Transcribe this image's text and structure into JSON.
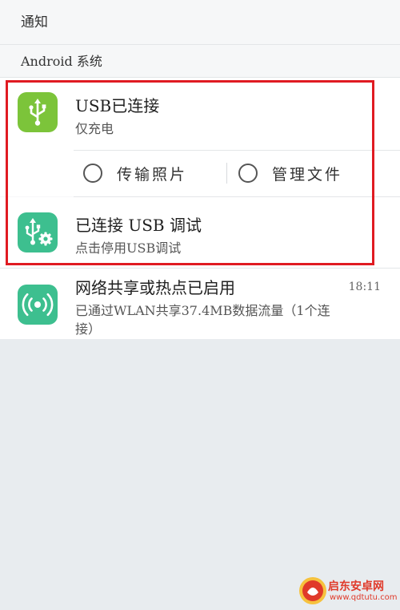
{
  "header": {
    "title": "通知"
  },
  "group": {
    "title": "Android 系统"
  },
  "notifications": [
    {
      "title": "USB已连接",
      "subtitle": "仅充电",
      "icon": "usb-icon",
      "icon_color": "#7cc43a",
      "actions": [
        {
          "label": "传输照片"
        },
        {
          "label": "管理文件"
        }
      ]
    },
    {
      "title": "已连接 USB 调试",
      "subtitle": "点击停用USB调试",
      "icon": "usb-debug-icon",
      "icon_color": "#3dbf8f"
    },
    {
      "title": "网络共享或热点已启用",
      "time": "18:11",
      "subtitle_line1": "已通过WLAN共享37.4MB数据流量（1个连",
      "subtitle_line2": "接）",
      "icon": "hotspot-icon",
      "icon_color": "#3dbf8f"
    }
  ],
  "watermark": {
    "name": "启东安卓网",
    "url": "www.qdtutu.com",
    "brand_color": "#e03a2a"
  },
  "colors": {
    "highlight_border": "#e01b22",
    "background": "#e8ecef"
  }
}
